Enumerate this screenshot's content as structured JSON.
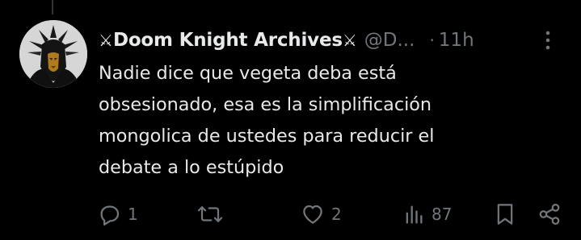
{
  "tweet": {
    "author": {
      "sword_left": "⚔",
      "display_name": "Doom Knight Archives",
      "sword_right": "⚔",
      "handle": "@D...",
      "avatar_icon": "dark-knight-helmet"
    },
    "separator": "·",
    "time": "11h",
    "text": "Nadie dice que vegeta deba está\nobsesionado, esa es la simplificación\nmongolica de ustedes para reducir el\ndebate a lo estúpido",
    "actions": {
      "replies": "1",
      "retweets": "",
      "likes": "2",
      "views": "87"
    }
  },
  "icons": {
    "more": "more-vertical-icon",
    "reply": "reply-icon",
    "retweet": "retweet-icon",
    "like": "heart-icon",
    "views": "views-chart-icon",
    "bookmark": "bookmark-icon",
    "share": "share-icon"
  },
  "colors": {
    "background": "#000000",
    "text_primary": "#e7e9ea",
    "text_secondary": "#71767b",
    "thread_line": "#333639"
  }
}
